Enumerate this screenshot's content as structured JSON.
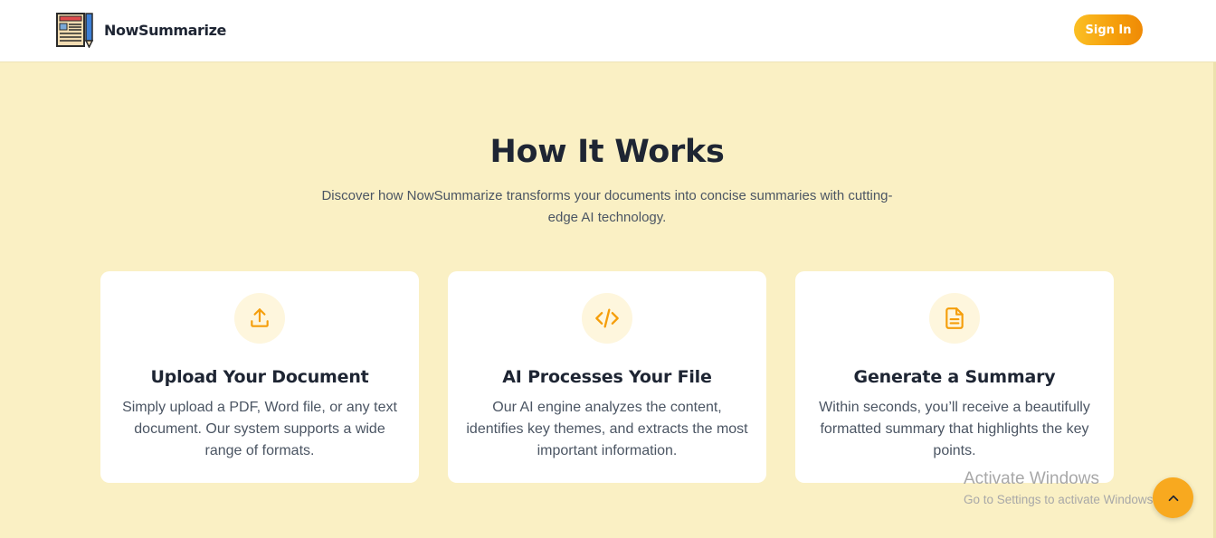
{
  "brand": {
    "name": "NowSummarize",
    "logo_icon": "newspaper-pencil-icon"
  },
  "nav": {
    "signin_label": "Sign In"
  },
  "hero": {
    "title": "How It Works",
    "subtitle": "Discover how NowSummarize transforms your documents into concise summaries with cutting-edge AI technology."
  },
  "cards": [
    {
      "icon": "upload-icon",
      "title": "Upload Your Document",
      "text": "Simply upload a PDF, Word file, or any text document. Our system supports a wide range of formats."
    },
    {
      "icon": "code-icon",
      "title": "AI Processes Your File",
      "text": "Our AI engine analyzes the content, identifies key themes, and extracts the most important information."
    },
    {
      "icon": "document-icon",
      "title": "Generate a Summary",
      "text": "Within seconds, you’ll receive a beautifully formatted summary that highlights the key points."
    }
  ],
  "watermark": {
    "title": "Activate Windows",
    "subtitle": "Go to Settings to activate Windows."
  },
  "scroll_top": {
    "icon": "chevron-up-icon"
  },
  "colors": {
    "accent": "#f59e0b",
    "background": "#faf0c4",
    "heading": "#1e2533",
    "body_text": "#4b5563"
  }
}
